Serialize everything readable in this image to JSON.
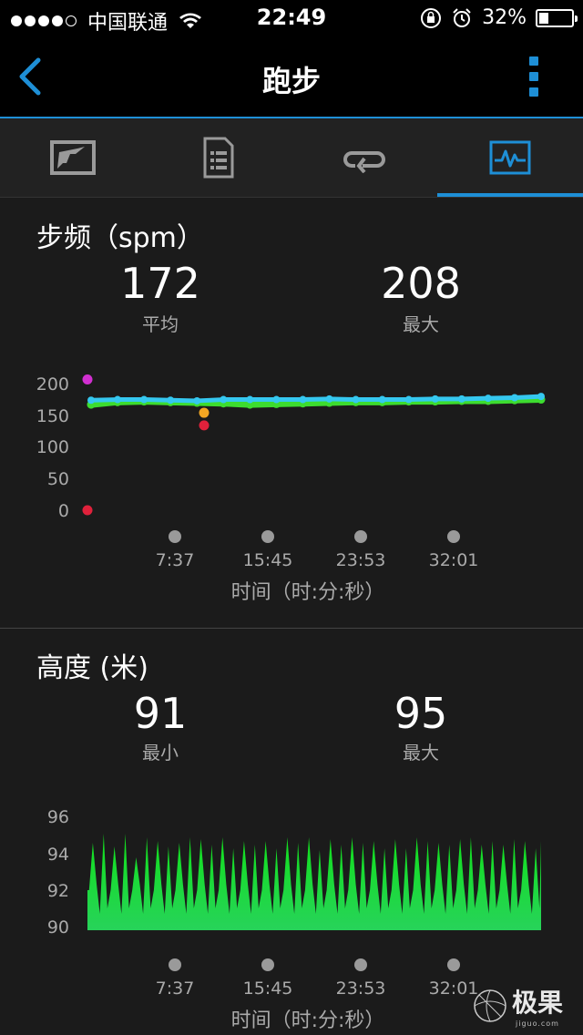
{
  "status_bar": {
    "carrier": "中国联通",
    "time": "22:49",
    "battery_pct": "32%",
    "battery_level": 0.32,
    "signal_bars": 4
  },
  "nav": {
    "title": "跑步",
    "back_icon": "chevron-left-icon",
    "more_icon": "more-vertical-icon"
  },
  "tabs": [
    {
      "icon": "map-route-icon"
    },
    {
      "icon": "summary-list-icon"
    },
    {
      "icon": "laps-loop-icon"
    },
    {
      "icon": "charts-waveform-icon",
      "active": true
    }
  ],
  "cadence": {
    "title": "步频（spm）",
    "avg_value": "172",
    "avg_label": "平均",
    "max_value": "208",
    "max_label": "最大",
    "chart_data": {
      "type": "scatter",
      "title": "步频（spm）",
      "ylabel": "",
      "xlabel": "时间（时:分:秒）",
      "y_ticks": [
        "200",
        "150",
        "100",
        "50",
        "0"
      ],
      "ylim": [
        0,
        200
      ],
      "x_ticks": [
        "7:37",
        "15:45",
        "23:53",
        "32:01"
      ],
      "series": [
        {
          "color": "#3ddc2f",
          "values": [
            168,
            172,
            173,
            172,
            171,
            170,
            168,
            169,
            170,
            171,
            172,
            172,
            173,
            173,
            174,
            174,
            175,
            176
          ]
        },
        {
          "color": "#35c8f0",
          "values": [
            175,
            176,
            176,
            175,
            174,
            176,
            176,
            176,
            176,
            177,
            176,
            176,
            176,
            177,
            177,
            178,
            179,
            181
          ]
        }
      ],
      "outliers": [
        {
          "value": 208,
          "color": "#d12fd0"
        },
        {
          "value": 155,
          "color": "#f2a623"
        },
        {
          "value": 135,
          "color": "#e0213b"
        },
        {
          "value": 0,
          "color": "#e0213b"
        }
      ]
    }
  },
  "altitude": {
    "title": "高度 (米)",
    "min_value": "91",
    "min_label": "最小",
    "max_value": "95",
    "max_label": "最大",
    "chart_data": {
      "type": "area",
      "title": "高度 (米)",
      "xlabel": "时间（时:分:秒）",
      "y_ticks": [
        "96",
        "94",
        "92",
        "90"
      ],
      "ylim": [
        89.3,
        96
      ],
      "x_ticks": [
        "7:37",
        "15:45",
        "23:53",
        "32:01"
      ],
      "fill_color": "#27d35a",
      "peaks": [
        94.1,
        94.6,
        93.9,
        94.6,
        93.3,
        94.4,
        94.2,
        93.9,
        94.1,
        94.4,
        94.3,
        94.0,
        94.4,
        93.8,
        94.2,
        94.0,
        94.2,
        93.8,
        94.4,
        94.1,
        94.4,
        93.7,
        94.3,
        94.0,
        94.4,
        94.1,
        94.2,
        93.8,
        94.3,
        93.8,
        94.4,
        94.2,
        94.1,
        94.0,
        94.3,
        94.4,
        94.0,
        94.2,
        94.0,
        94.3,
        94.2,
        93.8
      ],
      "valleys": [
        91.5,
        90.2
      ]
    }
  },
  "watermark": {
    "text": "极果",
    "sub": "jiguo.com"
  }
}
